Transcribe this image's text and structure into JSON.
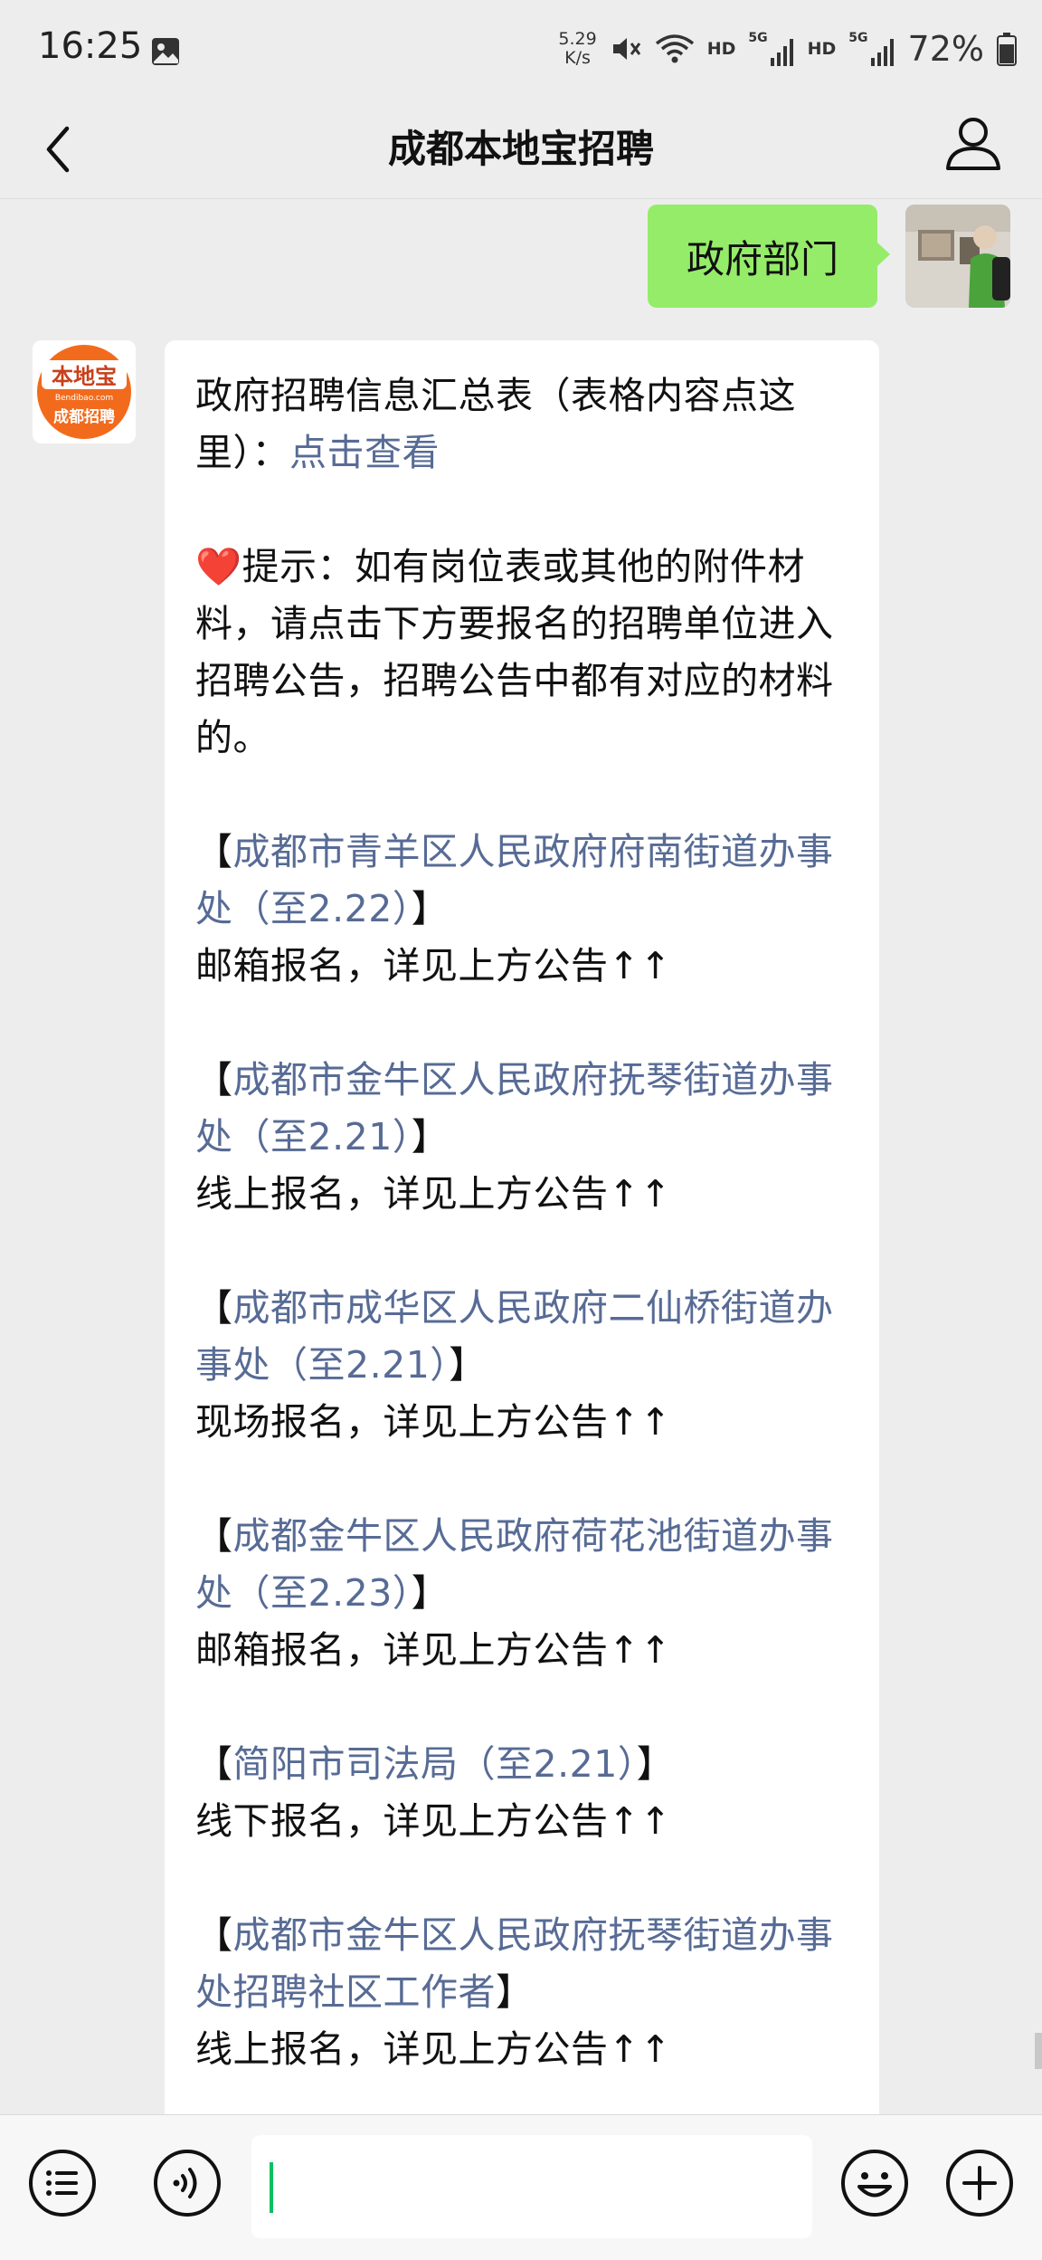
{
  "status_bar": {
    "time": "16:25",
    "speed_value": "5.29",
    "speed_unit": "K/s",
    "hd1": "HD",
    "net1": "5G",
    "hd2": "HD",
    "net2": "5G",
    "battery": "72%"
  },
  "nav": {
    "title": "成都本地宝招聘",
    "back_icon": "chevron-left-icon",
    "profile_icon": "user-icon"
  },
  "chat": {
    "sent_message": "政府部门",
    "bot_avatar_text_top": "本地宝",
    "bot_avatar_text_mid": "Bendibao.com",
    "bot_avatar_text_bottom": "成都招聘",
    "intro_text": "政府招聘信息汇总表（表格内容点这里）：",
    "intro_link": "点击查看",
    "tip_heart": "❤️",
    "tip_text": "提示：如有岗位表或其他的附件材料，请点击下方要报名的招聘单位进入招聘公告，招聘公告中都有对应的材料的。",
    "entries": [
      {
        "link": "成都市青羊区人民政府府南街道办事处（至2.22）",
        "note": "邮箱报名，详见上方公告↑↑"
      },
      {
        "link": "成都市金牛区人民政府抚琴街道办事处（至2.21）",
        "note": "线上报名，详见上方公告↑↑"
      },
      {
        "link": "成都市成华区人民政府二仙桥街道办事处（至2.21）",
        "note": "现场报名，详见上方公告↑↑"
      },
      {
        "link": "成都金牛区人民政府荷花池街道办事处（至2.23）",
        "note": "邮箱报名，详见上方公告↑↑"
      },
      {
        "link": "简阳市司法局（至2.21）",
        "note": "线下报名，详见上方公告↑↑"
      },
      {
        "link": "成都市金牛区人民政府抚琴街道办事处招聘社区工作者",
        "note": "线上报名，详见上方公告↑↑"
      }
    ],
    "bracket_open": "【",
    "bracket_close": "】"
  },
  "input_bar": {
    "menu_icon": "list-menu-icon",
    "voice_icon": "voice-icon",
    "emoji_icon": "emoji-icon",
    "plus_icon": "plus-icon",
    "input_value": ""
  }
}
